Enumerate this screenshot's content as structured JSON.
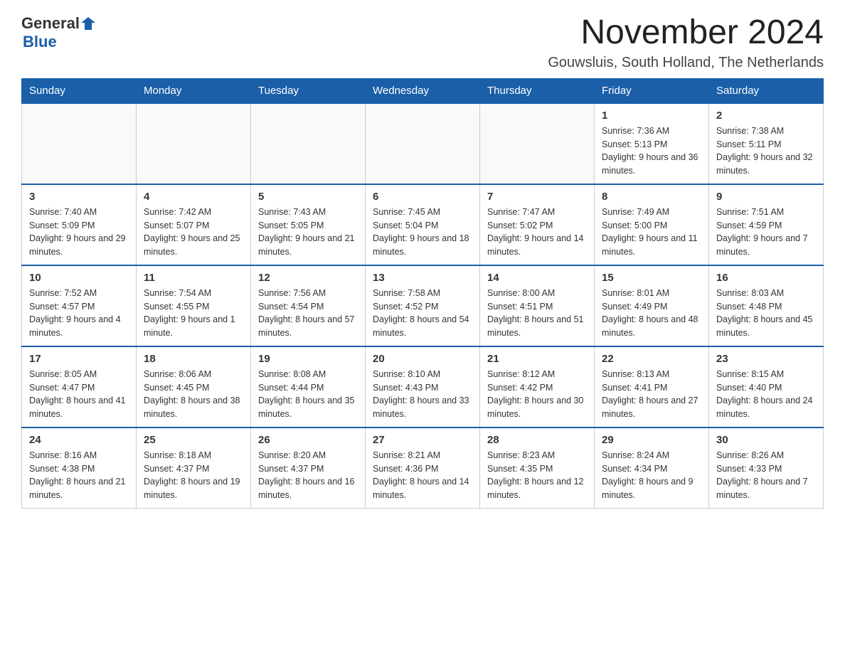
{
  "header": {
    "logo_general": "General",
    "logo_blue": "Blue",
    "month_title": "November 2024",
    "location": "Gouwsluis, South Holland, The Netherlands"
  },
  "weekdays": [
    "Sunday",
    "Monday",
    "Tuesday",
    "Wednesday",
    "Thursday",
    "Friday",
    "Saturday"
  ],
  "weeks": [
    [
      {
        "day": "",
        "info": ""
      },
      {
        "day": "",
        "info": ""
      },
      {
        "day": "",
        "info": ""
      },
      {
        "day": "",
        "info": ""
      },
      {
        "day": "",
        "info": ""
      },
      {
        "day": "1",
        "info": "Sunrise: 7:36 AM\nSunset: 5:13 PM\nDaylight: 9 hours and 36 minutes."
      },
      {
        "day": "2",
        "info": "Sunrise: 7:38 AM\nSunset: 5:11 PM\nDaylight: 9 hours and 32 minutes."
      }
    ],
    [
      {
        "day": "3",
        "info": "Sunrise: 7:40 AM\nSunset: 5:09 PM\nDaylight: 9 hours and 29 minutes."
      },
      {
        "day": "4",
        "info": "Sunrise: 7:42 AM\nSunset: 5:07 PM\nDaylight: 9 hours and 25 minutes."
      },
      {
        "day": "5",
        "info": "Sunrise: 7:43 AM\nSunset: 5:05 PM\nDaylight: 9 hours and 21 minutes."
      },
      {
        "day": "6",
        "info": "Sunrise: 7:45 AM\nSunset: 5:04 PM\nDaylight: 9 hours and 18 minutes."
      },
      {
        "day": "7",
        "info": "Sunrise: 7:47 AM\nSunset: 5:02 PM\nDaylight: 9 hours and 14 minutes."
      },
      {
        "day": "8",
        "info": "Sunrise: 7:49 AM\nSunset: 5:00 PM\nDaylight: 9 hours and 11 minutes."
      },
      {
        "day": "9",
        "info": "Sunrise: 7:51 AM\nSunset: 4:59 PM\nDaylight: 9 hours and 7 minutes."
      }
    ],
    [
      {
        "day": "10",
        "info": "Sunrise: 7:52 AM\nSunset: 4:57 PM\nDaylight: 9 hours and 4 minutes."
      },
      {
        "day": "11",
        "info": "Sunrise: 7:54 AM\nSunset: 4:55 PM\nDaylight: 9 hours and 1 minute."
      },
      {
        "day": "12",
        "info": "Sunrise: 7:56 AM\nSunset: 4:54 PM\nDaylight: 8 hours and 57 minutes."
      },
      {
        "day": "13",
        "info": "Sunrise: 7:58 AM\nSunset: 4:52 PM\nDaylight: 8 hours and 54 minutes."
      },
      {
        "day": "14",
        "info": "Sunrise: 8:00 AM\nSunset: 4:51 PM\nDaylight: 8 hours and 51 minutes."
      },
      {
        "day": "15",
        "info": "Sunrise: 8:01 AM\nSunset: 4:49 PM\nDaylight: 8 hours and 48 minutes."
      },
      {
        "day": "16",
        "info": "Sunrise: 8:03 AM\nSunset: 4:48 PM\nDaylight: 8 hours and 45 minutes."
      }
    ],
    [
      {
        "day": "17",
        "info": "Sunrise: 8:05 AM\nSunset: 4:47 PM\nDaylight: 8 hours and 41 minutes."
      },
      {
        "day": "18",
        "info": "Sunrise: 8:06 AM\nSunset: 4:45 PM\nDaylight: 8 hours and 38 minutes."
      },
      {
        "day": "19",
        "info": "Sunrise: 8:08 AM\nSunset: 4:44 PM\nDaylight: 8 hours and 35 minutes."
      },
      {
        "day": "20",
        "info": "Sunrise: 8:10 AM\nSunset: 4:43 PM\nDaylight: 8 hours and 33 minutes."
      },
      {
        "day": "21",
        "info": "Sunrise: 8:12 AM\nSunset: 4:42 PM\nDaylight: 8 hours and 30 minutes."
      },
      {
        "day": "22",
        "info": "Sunrise: 8:13 AM\nSunset: 4:41 PM\nDaylight: 8 hours and 27 minutes."
      },
      {
        "day": "23",
        "info": "Sunrise: 8:15 AM\nSunset: 4:40 PM\nDaylight: 8 hours and 24 minutes."
      }
    ],
    [
      {
        "day": "24",
        "info": "Sunrise: 8:16 AM\nSunset: 4:38 PM\nDaylight: 8 hours and 21 minutes."
      },
      {
        "day": "25",
        "info": "Sunrise: 8:18 AM\nSunset: 4:37 PM\nDaylight: 8 hours and 19 minutes."
      },
      {
        "day": "26",
        "info": "Sunrise: 8:20 AM\nSunset: 4:37 PM\nDaylight: 8 hours and 16 minutes."
      },
      {
        "day": "27",
        "info": "Sunrise: 8:21 AM\nSunset: 4:36 PM\nDaylight: 8 hours and 14 minutes."
      },
      {
        "day": "28",
        "info": "Sunrise: 8:23 AM\nSunset: 4:35 PM\nDaylight: 8 hours and 12 minutes."
      },
      {
        "day": "29",
        "info": "Sunrise: 8:24 AM\nSunset: 4:34 PM\nDaylight: 8 hours and 9 minutes."
      },
      {
        "day": "30",
        "info": "Sunrise: 8:26 AM\nSunset: 4:33 PM\nDaylight: 8 hours and 7 minutes."
      }
    ]
  ]
}
